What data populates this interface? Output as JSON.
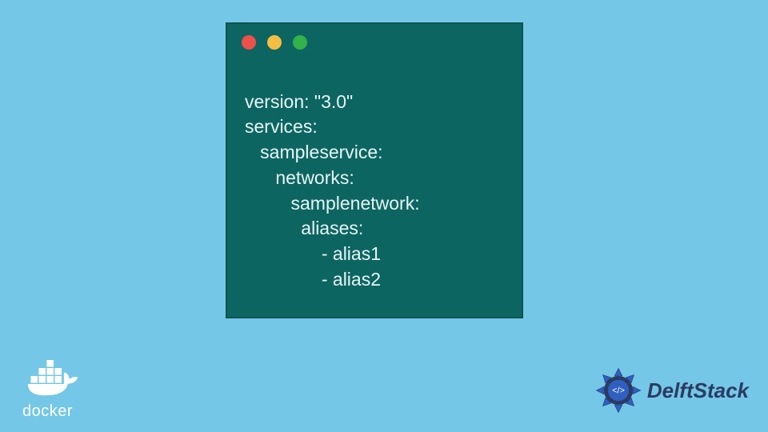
{
  "code": {
    "lines": [
      "version: \"3.0\"",
      "services:",
      "   sampleservice:",
      "      networks:",
      "         samplenetwork:",
      "           aliases:",
      "               - alias1",
      "               - alias2"
    ]
  },
  "logos": {
    "docker_label": "docker",
    "delftstack_label": "DelftStack"
  },
  "colors": {
    "background": "#74c7e7",
    "window_bg": "#0d6562",
    "window_border": "#0a524f",
    "code_text": "#e6f6f5",
    "traffic_red": "#ed5049",
    "traffic_yellow": "#f4be42",
    "traffic_green": "#32b24a",
    "delft_text": "#2b3b62",
    "delft_accent": "#2f5fbf"
  }
}
